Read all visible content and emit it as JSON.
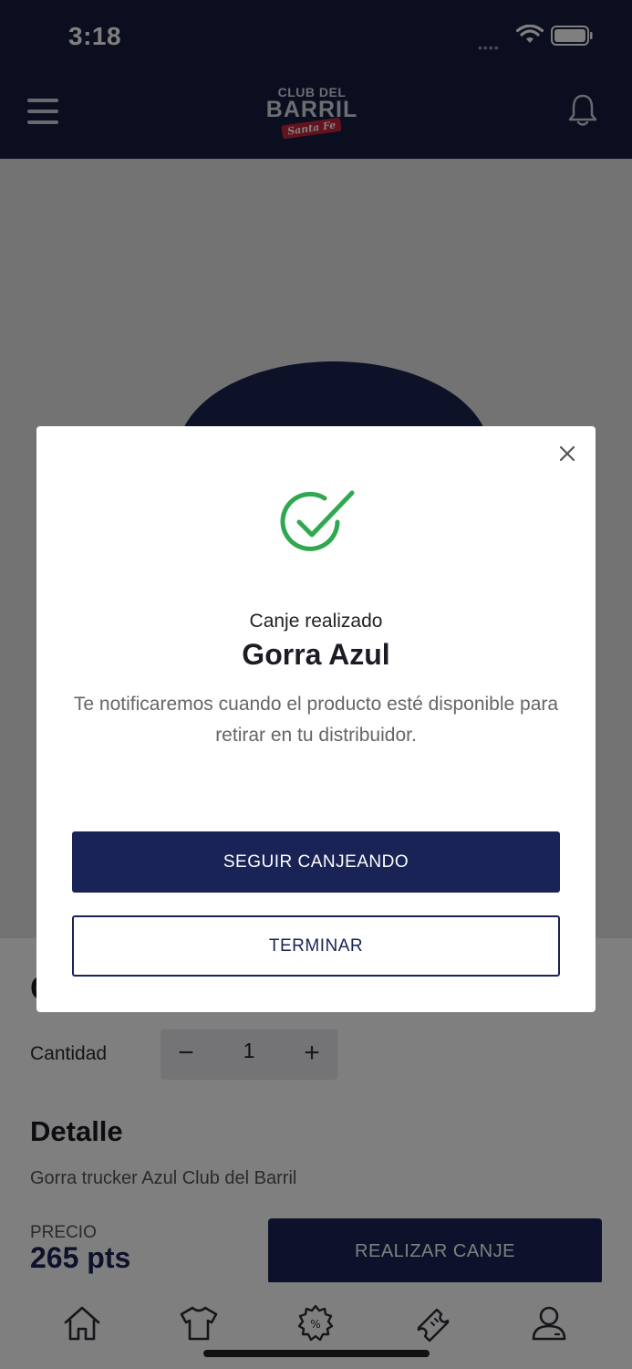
{
  "status_bar": {
    "time": "3:18",
    "signal": "••••"
  },
  "header": {
    "logo_line1": "CLUB DEL",
    "logo_line2": "BARRIL",
    "logo_tag": "Santa Fe",
    "menu_icon": "hamburger-icon",
    "bell_icon": "bell-icon"
  },
  "product": {
    "quantity_label": "Cantidad",
    "quantity_value": "1",
    "minus_label": "−",
    "plus_label": "+",
    "detail_title": "Detalle",
    "detail_text": "Gorra trucker Azul Club del Barril",
    "price_label": "PRECIO",
    "price_value": "265 pts",
    "redeem_button": "REALIZAR CANJE",
    "title_peek": "G"
  },
  "modal": {
    "close_icon": "close-icon",
    "success_icon": "check-circle-icon",
    "subtitle": "Canje realizado",
    "title": "Gorra Azul",
    "message": "Te notificaremos cuando el producto esté disponible para retirar en tu distribuidor.",
    "primary_button": "SEGUIR CANJEANDO",
    "secondary_button": "TERMINAR"
  },
  "tab_bar": {
    "tabs": [
      "home-icon",
      "shirt-icon",
      "discount-badge-icon",
      "ticket-icon",
      "user-icon"
    ]
  },
  "colors": {
    "navy": "#141d3f",
    "button_navy": "#1a2356",
    "success_green": "#2fa84f"
  }
}
